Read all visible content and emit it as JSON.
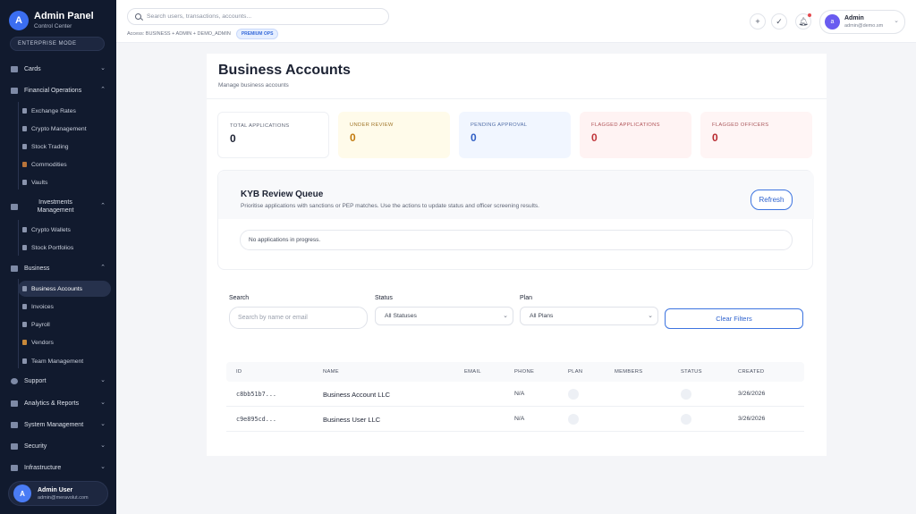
{
  "sidebar": {
    "brand_initial": "A",
    "brand_title": "Admin Panel",
    "brand_subtitle": "Control Center",
    "mode": "ENTERPRISE MODE",
    "groups": [
      {
        "label": "Cards",
        "chevron": "⌄"
      },
      {
        "label": "Financial Operations",
        "chevron": "⌃"
      },
      {
        "label": "Investments Management",
        "chevron": "⌃"
      },
      {
        "label": "Business",
        "chevron": "⌃"
      },
      {
        "label": "Support",
        "chevron": "⌄"
      },
      {
        "label": "Analytics & Reports",
        "chevron": "⌄"
      },
      {
        "label": "System Management",
        "chevron": "⌄"
      },
      {
        "label": "Security",
        "chevron": "⌄"
      },
      {
        "label": "Infrastructure",
        "chevron": "⌄"
      }
    ],
    "financial_items": [
      "Exchange Rates",
      "Crypto Management",
      "Stock Trading",
      "Commodities",
      "Vaults"
    ],
    "investment_items": [
      "Crypto Wallets",
      "Stock Portfolios"
    ],
    "business_items": [
      "Business Accounts",
      "Invoices",
      "Payroll",
      "Vendors",
      "Team Management"
    ],
    "active_item": "Business Accounts",
    "user": {
      "initial": "A",
      "name": "Admin User",
      "email": "admin@meravolut.com"
    }
  },
  "topbar": {
    "search_placeholder": "Search users, transactions, accounts...",
    "access_text": "Access: BUSINESS + ADMIN + DEMO_ADMIN",
    "premium_badge": "PREMIUM OPS",
    "icons": [
      "plus-icon",
      "check-circle-icon",
      "bell-icon"
    ],
    "account": {
      "initial": "a",
      "name": "Admin",
      "email": "admin@demo.sm"
    }
  },
  "page": {
    "title": "Business Accounts",
    "subtitle": "Manage business accounts"
  },
  "stats": [
    {
      "label": "TOTAL APPLICATIONS",
      "value": "0",
      "bg": "#ffffff",
      "color": "#1c2233",
      "label_color": "#5f6676"
    },
    {
      "label": "UNDER REVIEW",
      "value": "0",
      "bg": "#fffbea",
      "color": "#c27a0e",
      "label_color": "#a0762a"
    },
    {
      "label": "PENDING APPROVAL",
      "value": "0",
      "bg": "#f1f6ff",
      "color": "#2f5ec4",
      "label_color": "#5470a8"
    },
    {
      "label": "FLAGGED APPLICATIONS",
      "value": "0",
      "bg": "#fff3f3",
      "color": "#c0353a",
      "label_color": "#b05458"
    },
    {
      "label": "FLAGGED OFFICERS",
      "value": "0",
      "bg": "#fff5f5",
      "color": "#b7282e",
      "label_color": "#a9585c"
    }
  ],
  "kyb": {
    "title": "KYB Review Queue",
    "description": "Prioritise applications with sanctions or PEP matches. Use the actions to update status and officer screening results.",
    "refresh_label": "Refresh",
    "empty_text": "No applications in progress."
  },
  "filters": {
    "search_label": "Search",
    "search_placeholder": "Search by name or email",
    "status_label": "Status",
    "status_value": "All Statuses",
    "plan_label": "Plan",
    "plan_value": "All Plans",
    "clear_label": "Clear Filters"
  },
  "table": {
    "headers": [
      "ID",
      "NAME",
      "EMAIL",
      "PHONE",
      "PLAN",
      "MEMBERS",
      "STATUS",
      "CREATED"
    ],
    "rows": [
      {
        "id": "c8bb51b7...",
        "name": "Business Account LLC",
        "email": "",
        "phone": "N/A",
        "members": "",
        "created": "3/26/2026"
      },
      {
        "id": "c9e895cd...",
        "name": "Business User LLC",
        "email": "",
        "phone": "N/A",
        "members": "",
        "created": "3/26/2026"
      }
    ]
  }
}
